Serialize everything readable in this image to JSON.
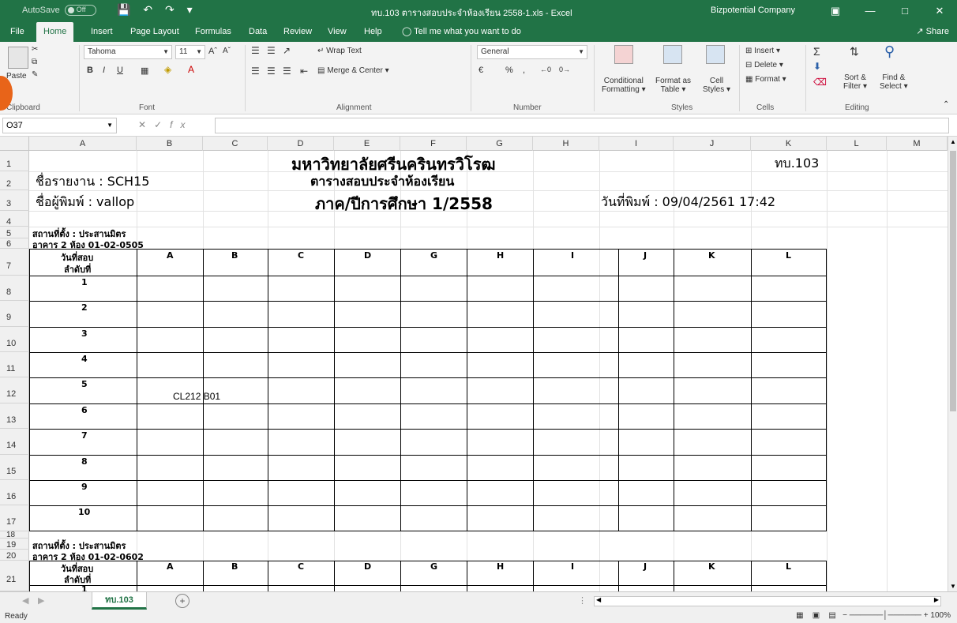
{
  "titlebar": {
    "autosave": "AutoSave",
    "autosave_state": "Off",
    "doc_title": "ทบ.103 ตารางสอบประจำห้องเรียน 2558-1.xls - Excel",
    "company": "Bizpotential Company"
  },
  "tabs": [
    "File",
    "Home",
    "Insert",
    "Page Layout",
    "Formulas",
    "Data",
    "Review",
    "View",
    "Help"
  ],
  "tell_me": "Tell me what you want to do",
  "share": "Share",
  "ribbon": {
    "paste": "Paste",
    "clipboard": "Clipboard",
    "font_name": "Tahoma",
    "font_size": "11",
    "font_group": "Font",
    "wrap_text": "Wrap Text",
    "merge_center": "Merge & Center",
    "alignment": "Alignment",
    "number_format": "General",
    "percent": "%",
    "number": "Number",
    "conditional": "Conditional",
    "formatting": "Formatting",
    "format_as": "Format as",
    "table": "Table",
    "cell": "Cell",
    "styles_btn": "Styles",
    "styles": "Styles",
    "insert": "Insert",
    "delete": "Delete",
    "format": "Format",
    "cells": "Cells",
    "sort_filter": "Sort &",
    "filter": "Filter",
    "find_select": "Find &",
    "select": "Select",
    "editing": "Editing"
  },
  "formula_bar": {
    "name_box": "O37",
    "fx": "fx"
  },
  "columns": [
    "A",
    "B",
    "C",
    "D",
    "E",
    "F",
    "G",
    "H",
    "I",
    "J",
    "K",
    "L",
    "M"
  ],
  "rows": [
    "1",
    "2",
    "3",
    "4",
    "5",
    "6",
    "7",
    "8",
    "9",
    "10",
    "11",
    "12",
    "13",
    "14",
    "15",
    "16",
    "17",
    "18",
    "19",
    "20",
    "21"
  ],
  "sheet": {
    "university": "มหาวิทยาลัยศรีนครินทรวิโรฒ",
    "code": "ทบ.103",
    "report_name": "ชื่อรายงาน : SCH15",
    "schedule_title": "ตารางสอบประจำห้องเรียน",
    "printer": "ชื่อผู้พิมพ์ : vallop",
    "semester": "ภาค/ปีการศึกษา 1/2558",
    "print_date": "วันที่พิมพ์ : 09/04/2561 17:42",
    "location1": "สถานที่ตั้ง : ประสานมิตร",
    "building1": "อาคาร 2 ห้อง 01-02-0505",
    "location2": "สถานที่ตั้ง : ประสานมิตร",
    "building2": "อาคาร 2 ห้อง 01-02-0602",
    "header_exam_date": "วันที่สอบ",
    "header_order": "ลำดับที่",
    "slot_columns": [
      "A",
      "B",
      "C",
      "D",
      "G",
      "H",
      "I",
      "J",
      "K",
      "L"
    ],
    "order_numbers": [
      "1",
      "2",
      "3",
      "4",
      "5",
      "6",
      "7",
      "8",
      "9",
      "10"
    ],
    "entry": "CL212 B01",
    "order_first_second": "1"
  },
  "sheet_tab": "ทบ.103",
  "status": {
    "ready": "Ready",
    "zoom": "100%"
  }
}
